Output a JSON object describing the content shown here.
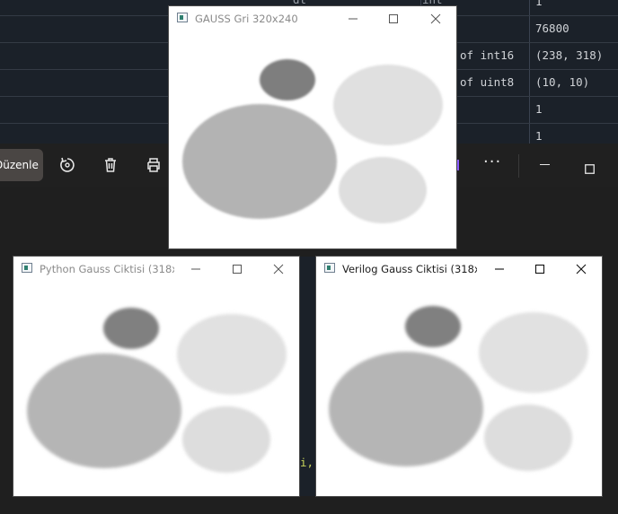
{
  "background_table": {
    "partial_left": "dt",
    "partial_type": "int",
    "rows": [
      {
        "type": "",
        "value": "1"
      },
      {
        "type": "",
        "value": "76800"
      },
      {
        "type": "of int16",
        "value": "(238, 318)"
      },
      {
        "type": "of uint8",
        "value": "(10, 10)"
      },
      {
        "type": "",
        "value": "1"
      },
      {
        "type": "",
        "value": "1"
      }
    ]
  },
  "toolbar": {
    "edit_label": "Düzenle",
    "more_label": "···"
  },
  "windows": [
    {
      "title": "GAUSS Gri 320x240"
    },
    {
      "title": "Python Gauss Ciktisi (318x..."
    },
    {
      "title": "Verilog Gauss Ciktisi (318x..."
    }
  ],
  "code_fragment": "i,",
  "colors": {
    "ellipse_small": "#808080",
    "ellipse_large": "#b5b5b5",
    "ellipse_light": "#e1e1e1",
    "ellipse_light2": "#dddddd"
  }
}
